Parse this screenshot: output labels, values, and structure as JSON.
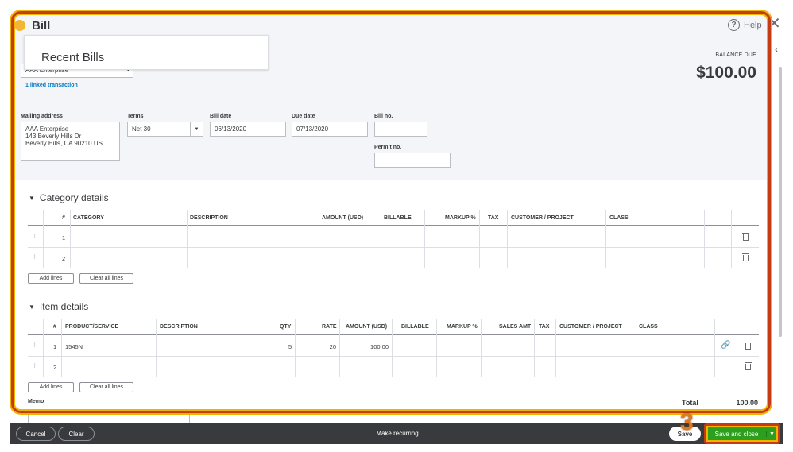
{
  "window": {
    "title": "Bill",
    "help_label": "Help"
  },
  "vendor": {
    "value": "AAA Enterprise",
    "recent_bills_label": "Recent Bills",
    "linked_transaction": "1 linked transaction"
  },
  "balance": {
    "label": "BALANCE DUE",
    "amount": "$100.00"
  },
  "fields": {
    "mailing_address_label": "Mailing address",
    "mailing_address_lines": [
      "AAA Enterprise",
      "143 Beverly Hills Dr",
      "Beverly Hills, CA  90210 US"
    ],
    "terms_label": "Terms",
    "terms_value": "Net 30",
    "bill_date_label": "Bill date",
    "bill_date_value": "06/13/2020",
    "due_date_label": "Due date",
    "due_date_value": "07/13/2020",
    "bill_no_label": "Bill no.",
    "bill_no_value": "",
    "permit_no_label": "Permit no.",
    "permit_no_value": ""
  },
  "category_details": {
    "title": "Category details",
    "columns": [
      "#",
      "CATEGORY",
      "DESCRIPTION",
      "AMOUNT (USD)",
      "BILLABLE",
      "MARKUP %",
      "TAX",
      "CUSTOMER / PROJECT",
      "CLASS"
    ],
    "rows": [
      {
        "num": "1"
      },
      {
        "num": "2"
      }
    ],
    "add_lines": "Add lines",
    "clear_all_lines": "Clear all lines"
  },
  "item_details": {
    "title": "Item details",
    "columns": [
      "#",
      "PRODUCT/SERVICE",
      "DESCRIPTION",
      "QTY",
      "RATE",
      "AMOUNT (USD)",
      "BILLABLE",
      "MARKUP %",
      "SALES AMT",
      "TAX",
      "CUSTOMER / PROJECT",
      "CLASS"
    ],
    "rows": [
      {
        "num": "1",
        "product": "1545N",
        "qty": "5",
        "rate": "20",
        "amount": "100.00"
      },
      {
        "num": "2",
        "product": "",
        "qty": "",
        "rate": "",
        "amount": ""
      }
    ],
    "add_lines": "Add lines",
    "clear_all_lines": "Clear all lines"
  },
  "memo_label": "Memo",
  "total": {
    "label": "Total",
    "value": "100.00"
  },
  "footer": {
    "cancel": "Cancel",
    "clear": "Clear",
    "make_recurring": "Make recurring",
    "save": "Save",
    "save_and_close": "Save and close"
  },
  "annotation": {
    "step_number": "3"
  },
  "colors": {
    "primary_green": "#2ca01c",
    "highlight_red": "#c53b12",
    "highlight_yellow": "#f0b400",
    "link_blue": "#0077c5"
  }
}
